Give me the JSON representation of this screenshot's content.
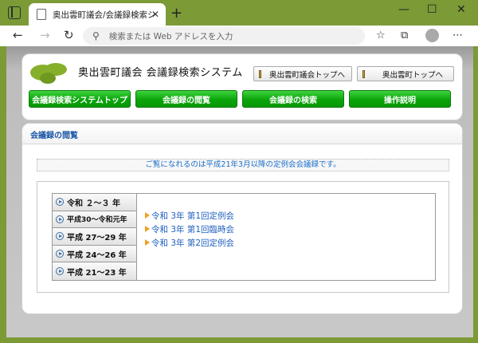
{
  "browser": {
    "tab_title": "奥出雲町議会/会議録検索システム",
    "close_symbol": "✕",
    "newtab_symbol": "+",
    "win_min": "—",
    "win_max": "☐",
    "win_close": "✕",
    "address_placeholder": "検索または Web アドレスを入力",
    "back": "←",
    "forward": "→",
    "refresh": "↻",
    "search_glyph": "⚲",
    "fav_icon": "☆",
    "collections_icon": "⧉",
    "more_icon": "⋯"
  },
  "site": {
    "title": "奥出雲町議会 会議録検索システム",
    "top_buttons": [
      "奥出雲町議会トップへ",
      "奥出雲町トップへ"
    ],
    "nav": [
      "会議録検索システムトップ",
      "会議録の閲覧",
      "会議録の検索",
      "操作説明"
    ]
  },
  "browse": {
    "heading": "会議録の閲覧",
    "notice": "ご覧になれるのは平成21年3月以降の定例会会議録です。",
    "years": [
      "令和 ２～３ 年",
      "平成30～令和元年",
      "平成 27～29 年",
      "平成 24～26 年",
      "平成 21～23 年"
    ],
    "sessions": [
      "令和 3年 第1回定例会",
      "令和 3年 第1回臨時会",
      "令和 3年 第2回定例会"
    ]
  },
  "colors": {
    "frame": "#7c9a36",
    "nav_green": "#0ba50b",
    "link_blue": "#1f5fbf",
    "arrow_orange": "#f0a020"
  }
}
